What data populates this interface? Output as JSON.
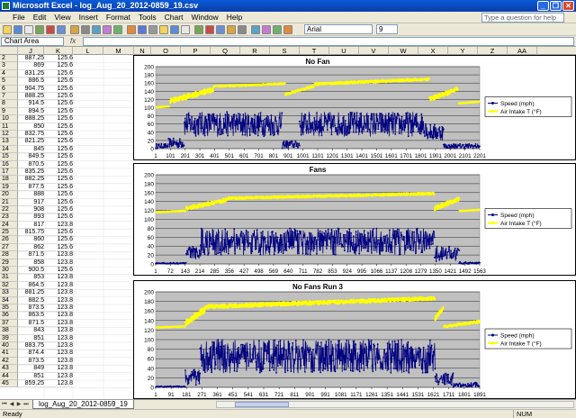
{
  "window": {
    "title": "Microsoft Excel - log_Aug_20_2012-0859_19.csv",
    "minimize_label": "_",
    "maximize_label": "❐",
    "close_label": "✕"
  },
  "menu": {
    "items": [
      "File",
      "Edit",
      "View",
      "Insert",
      "Format",
      "Tools",
      "Chart",
      "Window",
      "Help"
    ],
    "help_placeholder": "Type a question for help"
  },
  "toolbar": {
    "font_name": "Arial",
    "font_size": "9"
  },
  "formula_bar": {
    "name_box": "Chart Area",
    "fx_label": "fx"
  },
  "columns": [
    "J",
    "K",
    "L",
    "M",
    "N",
    "O",
    "P",
    "Q",
    "R",
    "S",
    "T",
    "U",
    "V",
    "W",
    "X",
    "Y",
    "Z",
    "AA"
  ],
  "rows": [
    {
      "n": "2",
      "j": "887.25",
      "k": "125.6"
    },
    {
      "n": "3",
      "j": "869",
      "k": "125.6"
    },
    {
      "n": "4",
      "j": "831.25",
      "k": "125.6"
    },
    {
      "n": "5",
      "j": "886.5",
      "k": "125.6"
    },
    {
      "n": "6",
      "j": "904.75",
      "k": "125.6"
    },
    {
      "n": "7",
      "j": "888.25",
      "k": "125.6"
    },
    {
      "n": "8",
      "j": "914.5",
      "k": "125.6"
    },
    {
      "n": "9",
      "j": "894.5",
      "k": "125.6"
    },
    {
      "n": "10",
      "j": "888.25",
      "k": "125.6"
    },
    {
      "n": "11",
      "j": "850",
      "k": "125.6"
    },
    {
      "n": "12",
      "j": "832.75",
      "k": "125.6"
    },
    {
      "n": "13",
      "j": "821.25",
      "k": "125.6"
    },
    {
      "n": "14",
      "j": "845",
      "k": "125.6"
    },
    {
      "n": "15",
      "j": "849.5",
      "k": "125.6"
    },
    {
      "n": "16",
      "j": "870.5",
      "k": "125.6"
    },
    {
      "n": "17",
      "j": "835.25",
      "k": "125.6"
    },
    {
      "n": "18",
      "j": "882.25",
      "k": "125.6"
    },
    {
      "n": "19",
      "j": "877.5",
      "k": "125.6"
    },
    {
      "n": "20",
      "j": "888",
      "k": "125.6"
    },
    {
      "n": "21",
      "j": "917",
      "k": "125.6"
    },
    {
      "n": "22",
      "j": "908",
      "k": "125.6"
    },
    {
      "n": "23",
      "j": "893",
      "k": "125.6"
    },
    {
      "n": "24",
      "j": "817",
      "k": "123.8"
    },
    {
      "n": "25",
      "j": "815.75",
      "k": "125.6"
    },
    {
      "n": "26",
      "j": "860",
      "k": "125.6"
    },
    {
      "n": "27",
      "j": "862",
      "k": "125.6"
    },
    {
      "n": "28",
      "j": "871.5",
      "k": "123.8"
    },
    {
      "n": "29",
      "j": "858",
      "k": "123.8"
    },
    {
      "n": "30",
      "j": "900.5",
      "k": "125.6"
    },
    {
      "n": "31",
      "j": "853",
      "k": "123.8"
    },
    {
      "n": "32",
      "j": "864.5",
      "k": "123.8"
    },
    {
      "n": "33",
      "j": "881.25",
      "k": "123.8"
    },
    {
      "n": "34",
      "j": "882.5",
      "k": "123.8"
    },
    {
      "n": "35",
      "j": "873.5",
      "k": "123.8"
    },
    {
      "n": "36",
      "j": "863.5",
      "k": "123.8"
    },
    {
      "n": "37",
      "j": "871.5",
      "k": "123.8"
    },
    {
      "n": "38",
      "j": "843",
      "k": "123.8"
    },
    {
      "n": "39",
      "j": "851",
      "k": "123.8"
    },
    {
      "n": "40",
      "j": "883.75",
      "k": "123.8"
    },
    {
      "n": "41",
      "j": "874.4",
      "k": "123.8"
    },
    {
      "n": "42",
      "j": "873.5",
      "k": "123.8"
    },
    {
      "n": "43",
      "j": "849",
      "k": "123.8"
    },
    {
      "n": "44",
      "j": "851",
      "k": "123.8"
    },
    {
      "n": "45",
      "j": "859.25",
      "k": "123.8"
    }
  ],
  "sheet_tab": "log_Aug_20_2012-0859_19",
  "status": {
    "left": "Ready",
    "num": "NUM"
  },
  "chart_data": [
    {
      "type": "line",
      "title": "No Fan",
      "ylim": [
        0,
        200
      ],
      "yticks": [
        0,
        20,
        40,
        60,
        80,
        100,
        120,
        140,
        160,
        180,
        200
      ],
      "xtick_labels": [
        "1",
        "101",
        "201",
        "301",
        "401",
        "501",
        "601",
        "701",
        "801",
        "901",
        "1001",
        "1101",
        "1201",
        "1301",
        "1401",
        "1501",
        "1601",
        "1701",
        "1801",
        "1901",
        "2001",
        "2101",
        "2201"
      ],
      "n_points": 2250,
      "series": [
        {
          "name": "Speed (mph)",
          "color": "#000080",
          "segments": [
            {
              "from": 1,
              "to": 90,
              "low": 0,
              "high": 12
            },
            {
              "from": 90,
              "to": 200,
              "low": 2,
              "high": 25
            },
            {
              "from": 200,
              "to": 880,
              "low": 30,
              "high": 90
            },
            {
              "from": 880,
              "to": 1000,
              "low": 0,
              "high": 20
            },
            {
              "from": 1000,
              "to": 1880,
              "low": 30,
              "high": 90
            },
            {
              "from": 1880,
              "to": 2000,
              "low": 20,
              "high": 60
            },
            {
              "from": 2000,
              "to": 2250,
              "low": 0,
              "high": 12
            }
          ]
        },
        {
          "name": "Air Intake T (°F)",
          "color": "#ffff00",
          "segments": [
            {
              "from": 1,
              "to": 100,
              "low": 100,
              "high": 104
            },
            {
              "from": 100,
              "to": 400,
              "low": 110,
              "high": 150
            },
            {
              "from": 400,
              "to": 900,
              "low": 150,
              "high": 160
            },
            {
              "from": 900,
              "to": 1000,
              "low": 130,
              "high": 145
            },
            {
              "from": 1000,
              "to": 1100,
              "low": 140,
              "high": 155
            },
            {
              "from": 1100,
              "to": 1900,
              "low": 155,
              "high": 172
            },
            {
              "from": 1900,
              "to": 2100,
              "low": 115,
              "high": 150
            },
            {
              "from": 2100,
              "to": 2250,
              "low": 110,
              "high": 115
            }
          ]
        }
      ]
    },
    {
      "type": "line",
      "title": "Fans",
      "ylim": [
        0,
        200
      ],
      "yticks": [
        0,
        20,
        40,
        60,
        80,
        100,
        120,
        140,
        160,
        180,
        200
      ],
      "xtick_labels": [
        "1",
        "72",
        "143",
        "214",
        "285",
        "356",
        "427",
        "498",
        "569",
        "640",
        "711",
        "782",
        "853",
        "924",
        "995",
        "1066",
        "1137",
        "1208",
        "1279",
        "1350",
        "1421",
        "1492",
        "1563"
      ],
      "n_points": 1580,
      "series": [
        {
          "name": "Speed (mph)",
          "color": "#000080",
          "segments": [
            {
              "from": 1,
              "to": 150,
              "low": 0,
              "high": 3
            },
            {
              "from": 150,
              "to": 220,
              "low": 10,
              "high": 40
            },
            {
              "from": 220,
              "to": 1360,
              "low": 20,
              "high": 80
            },
            {
              "from": 1360,
              "to": 1480,
              "low": 5,
              "high": 40
            },
            {
              "from": 1480,
              "to": 1580,
              "low": 0,
              "high": 5
            }
          ]
        },
        {
          "name": "Air Intake T (°F)",
          "color": "#ffff00",
          "segments": [
            {
              "from": 1,
              "to": 150,
              "low": 115,
              "high": 120
            },
            {
              "from": 150,
              "to": 350,
              "low": 120,
              "high": 148
            },
            {
              "from": 350,
              "to": 1360,
              "low": 145,
              "high": 160
            },
            {
              "from": 1360,
              "to": 1480,
              "low": 120,
              "high": 150
            },
            {
              "from": 1480,
              "to": 1580,
              "low": 118,
              "high": 122
            }
          ]
        }
      ]
    },
    {
      "type": "line",
      "title": "No Fans Run 3",
      "ylim": [
        0,
        200
      ],
      "yticks": [
        0,
        20,
        40,
        60,
        80,
        100,
        120,
        140,
        160,
        180,
        200
      ],
      "xtick_labels": [
        "1",
        "91",
        "181",
        "271",
        "361",
        "451",
        "541",
        "631",
        "721",
        "811",
        "901",
        "991",
        "1081",
        "1171",
        "1261",
        "1351",
        "1441",
        "1531",
        "1621",
        "1711",
        "1801",
        "1891"
      ],
      "n_points": 1960,
      "series": [
        {
          "name": "Speed (mph)",
          "color": "#000080",
          "segments": [
            {
              "from": 1,
              "to": 180,
              "low": 0,
              "high": 3
            },
            {
              "from": 180,
              "to": 270,
              "low": 5,
              "high": 40
            },
            {
              "from": 270,
              "to": 1690,
              "low": 30,
              "high": 100
            },
            {
              "from": 1690,
              "to": 1800,
              "low": 5,
              "high": 30
            },
            {
              "from": 1800,
              "to": 1960,
              "low": 0,
              "high": 10
            }
          ]
        },
        {
          "name": "Air Intake T (°F)",
          "color": "#ffff00",
          "segments": [
            {
              "from": 1,
              "to": 180,
              "low": 125,
              "high": 128
            },
            {
              "from": 180,
              "to": 300,
              "low": 128,
              "high": 170
            },
            {
              "from": 300,
              "to": 1690,
              "low": 165,
              "high": 190
            },
            {
              "from": 1690,
              "to": 1740,
              "low": 140,
              "high": 170
            },
            {
              "from": 1740,
              "to": 1960,
              "low": 125,
              "high": 140
            }
          ]
        }
      ]
    }
  ]
}
